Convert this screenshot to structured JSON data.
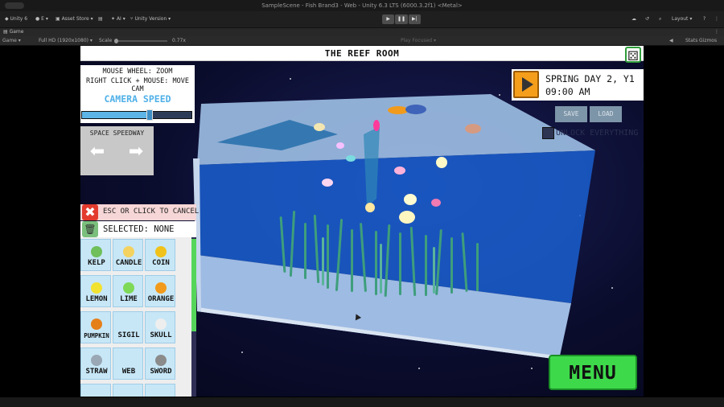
{
  "editor": {
    "window_title": "SampleScene - Fish Brand3 - Web - Unity 6.3 LTS (6000.3.2f1) <Metal>",
    "unity_label": "Unity 6",
    "account_label": "E",
    "asset_store": "Asset Store",
    "ai_label": "AI",
    "version_control": "Unity Version",
    "layout_label": "Layout",
    "tab_game": "Game",
    "display": "Game",
    "resolution": "Full HD (1920x1080)",
    "scale_label": "Scale",
    "scale_value": "0.77x",
    "play_focused": "Play Focused",
    "stats": "Stats",
    "gizmos": "Gizmos"
  },
  "game": {
    "room_title": "THE REEF ROOM",
    "help_line1": "MOUSE WHEEL: ZOOM",
    "help_line2": "RIGHT CLICK + MOUSE: MOVE CAM",
    "camera_speed_label": "CAMERA SPEED",
    "camera_speed_level": 0.62,
    "speedway_label": "SPACE SPEEDWAY",
    "cancel_text": "ESC OR CLICK TO CANCEL",
    "selected_text": "SELECTED: NONE",
    "items": [
      {
        "label": "KELP",
        "color": "#6fbf5a"
      },
      {
        "label": "CANDLE",
        "color": "#f3d25f"
      },
      {
        "label": "COIN",
        "color": "#f1c21b"
      },
      {
        "label": "LEMON",
        "color": "#f2e231"
      },
      {
        "label": "LIME",
        "color": "#7ed957"
      },
      {
        "label": "ORANGE",
        "color": "#f29a1b"
      },
      {
        "label": "PUMPKIN",
        "color": "#e57f1a"
      },
      {
        "label": "SIGIL",
        "color": "#c7e7f7"
      },
      {
        "label": "SKULL",
        "color": "#eeeeee"
      },
      {
        "label": "STRAW",
        "color": "#9aa7b5"
      },
      {
        "label": "WEB",
        "color": "#c7e7f7"
      },
      {
        "label": "SWORD",
        "color": "#8b8b8b"
      }
    ],
    "season_line": "SPRING DAY 2, Y1",
    "time_line": "09:00 AM",
    "save_label": "SAVE",
    "load_label": "LOAD",
    "unlock_label": "UNLOCK EVERYTHING",
    "menu_label": "MENU",
    "colors": {
      "accent_green": "#3ed94b",
      "camera_blue": "#4fb0e8",
      "play_orange": "#f59e1c",
      "cancel_red": "#e23b2e"
    }
  }
}
